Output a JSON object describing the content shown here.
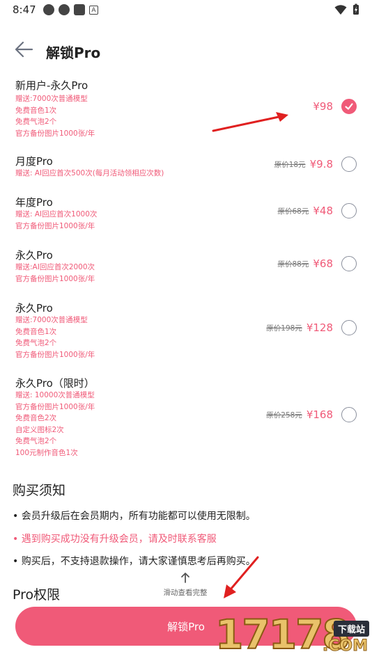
{
  "status_bar": {
    "time": "8:47",
    "badge_letter": "A"
  },
  "header": {
    "title": "解锁Pro"
  },
  "plans": [
    {
      "name": "新用户-永久Pro",
      "desc": [
        "赠送:7000次普通模型",
        "免费音色1次",
        "免费气泡2个",
        "官方备份图片1000张/年"
      ],
      "original_price": "",
      "price": "¥98",
      "selected": true
    },
    {
      "name": "月度Pro",
      "desc": [
        "赠送: AI回应首次500次(每月活动领相应次数)"
      ],
      "original_price": "原价18元",
      "price": "¥9.8",
      "selected": false
    },
    {
      "name": "年度Pro",
      "desc": [
        "赠送: AI回应首次1000次",
        "官方备份图片1000张/年"
      ],
      "original_price": "原价68元",
      "price": "¥48",
      "selected": false
    },
    {
      "name": "永久Pro",
      "desc": [
        "赠送:AI回应首次2000次",
        "官方备份图片1000张/年"
      ],
      "original_price": "原价88元",
      "price": "¥68",
      "selected": false
    },
    {
      "name": "永久Pro",
      "desc": [
        "赠送:7000次普通模型",
        "免费音色1次",
        "免费气泡2个",
        "官方备份图片1000张/年"
      ],
      "original_price": "原价198元",
      "price": "¥128",
      "selected": false
    },
    {
      "name": "永久Pro（限时）",
      "desc": [
        "赠送: 10000次普通模型",
        "官方备份图片1000张/年",
        "免费音色2次",
        "自定义图标2次",
        "免费气泡2个",
        "100元制作音色1次"
      ],
      "original_price": "原价258元",
      "price": "¥168",
      "selected": false
    }
  ],
  "notice": {
    "title": "购买须知",
    "items": [
      "• 会员升级后在会员期内，所有功能都可以使用无限制。",
      "• 遇到购买成功没有升级会员，请及时联系客服",
      "• 购买后，不支持退款操作，请大家谨慎思考后再购买。"
    ]
  },
  "permissions": {
    "title": "Pro权限"
  },
  "scroll_hint": "滑动查看完整",
  "unlock_button": "解锁Pro",
  "watermark": {
    "number": "17178",
    "badge": "下载站",
    "domain": ".COM"
  },
  "colors": {
    "accent": "#f05a78",
    "annotation_arrow": "#e02020"
  }
}
